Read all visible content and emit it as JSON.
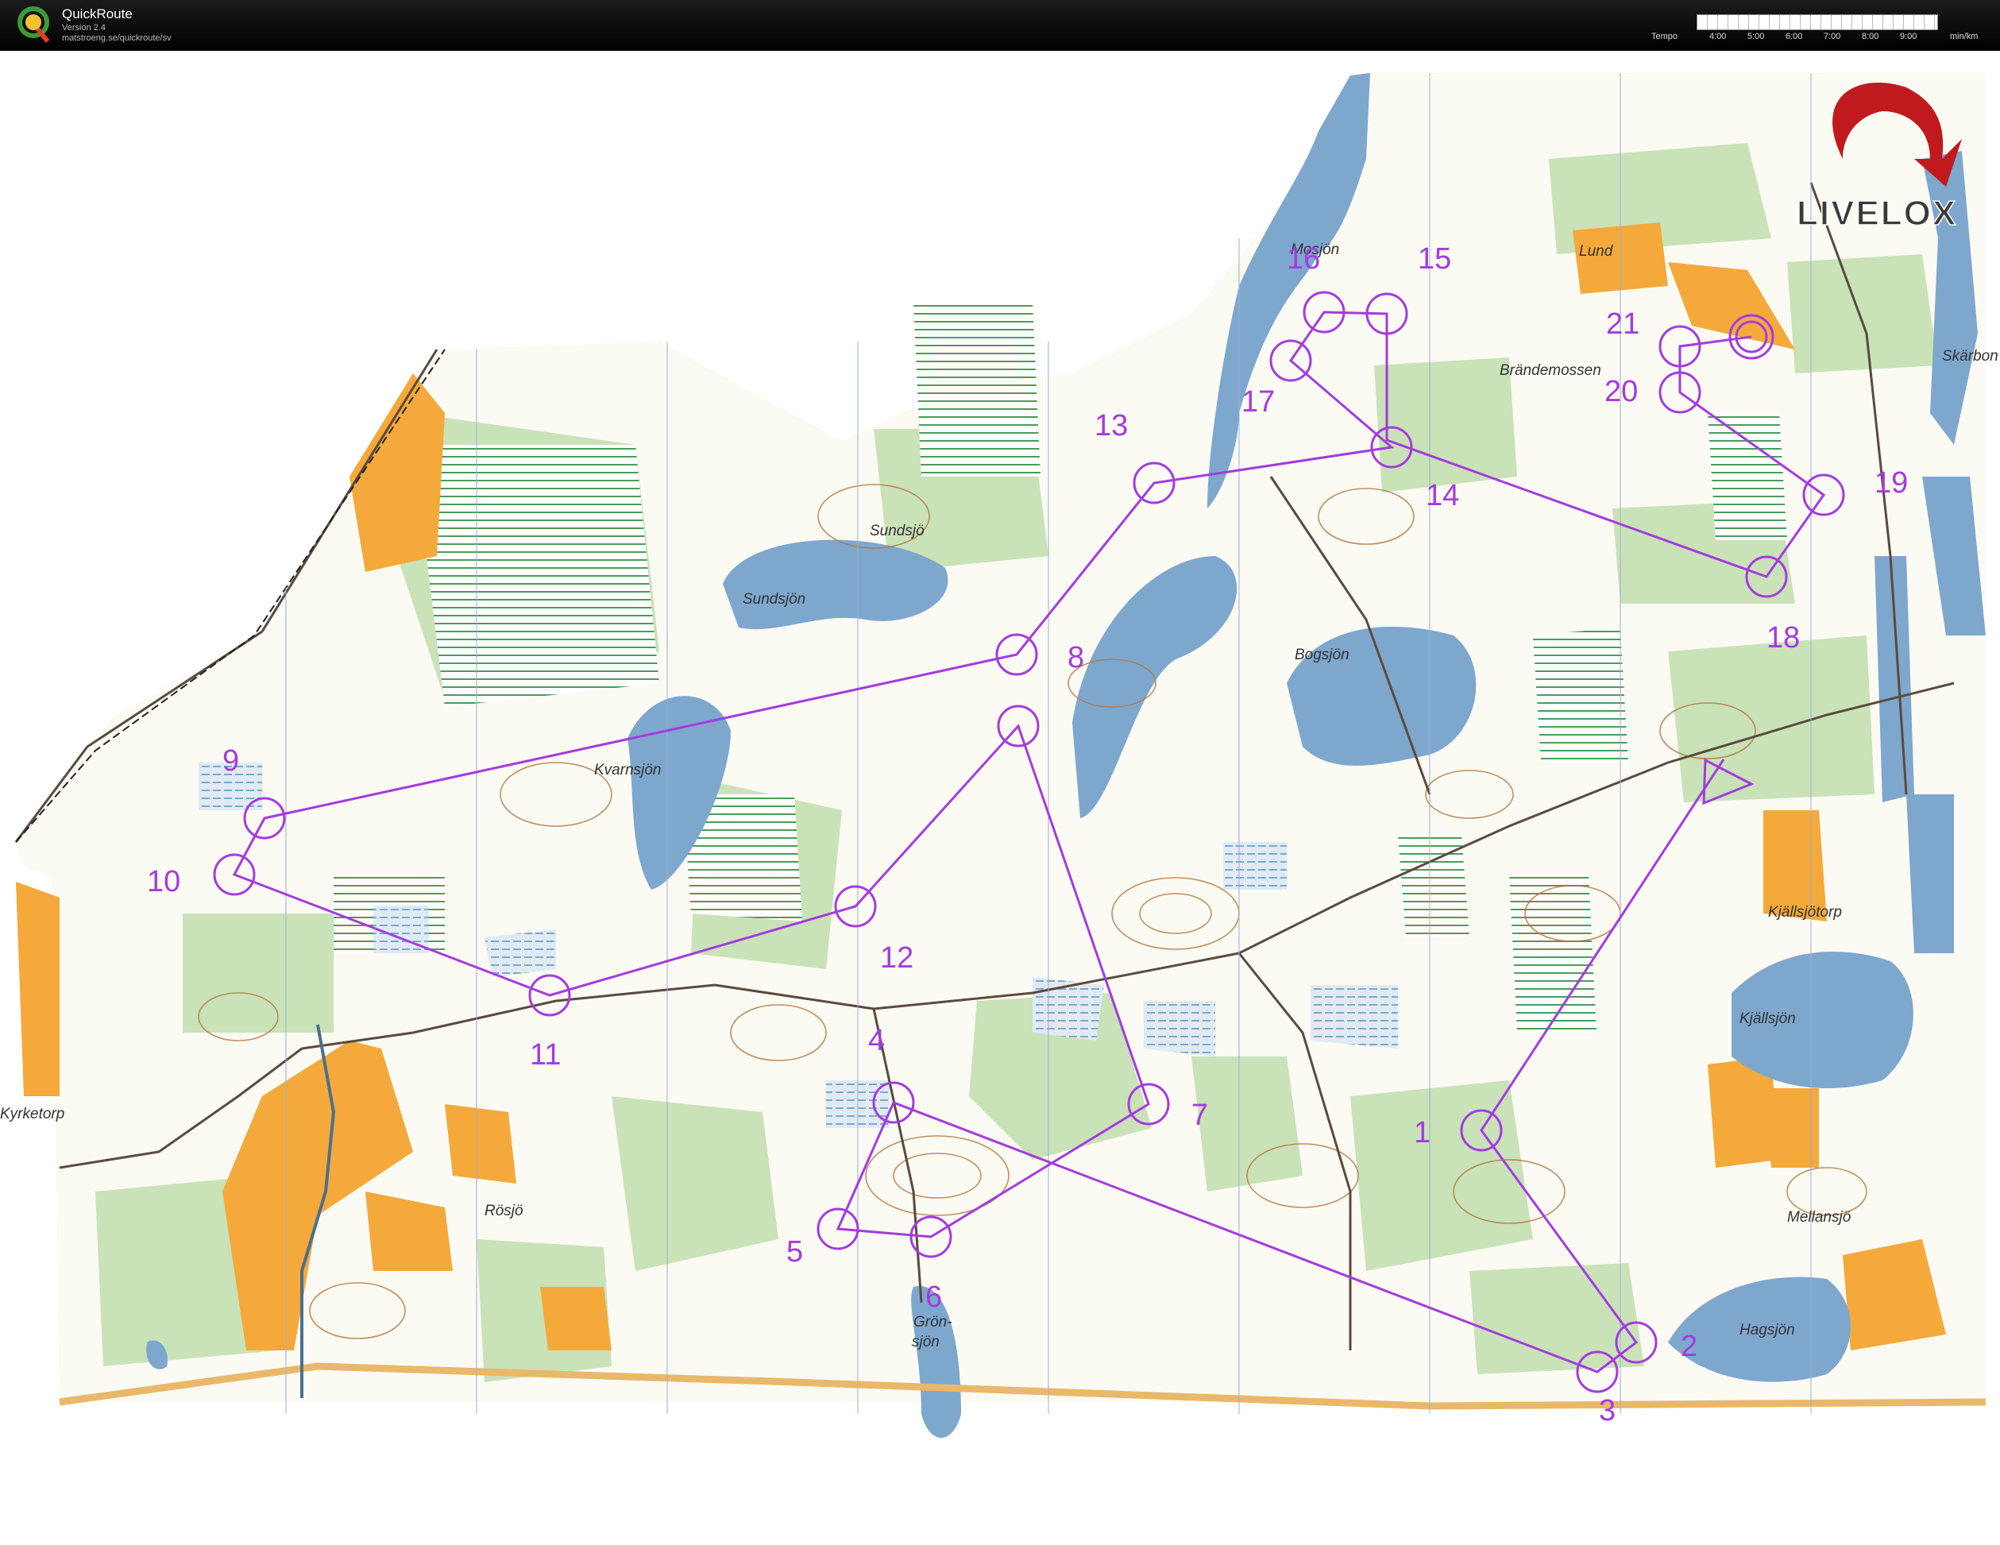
{
  "app": {
    "name": "QuickRoute",
    "version": "Version 2.4",
    "url": "matstroeng.se/quickroute/sv",
    "tempo_label": "Tempo",
    "tempo_ticks": [
      "4:00",
      "5:00",
      "6:00",
      "7:00",
      "8:00",
      "9:00"
    ],
    "tempo_unit": "min/km"
  },
  "brand": {
    "text": "LIVELOX",
    "arrow_color": "#c0191e"
  },
  "map": {
    "course_color": "#a43be0",
    "colors": {
      "water": "#7ea7ce",
      "open_land": "#f4a93a",
      "green": "#c9e2b8",
      "marsh": "#4a9c5a",
      "contour": "#b4743a",
      "road": "#5b4a3e",
      "track": "#e9b86a"
    },
    "place_names": [
      "Sundsjö",
      "Sundsjön",
      "Kvarnsjön",
      "Bogsjön",
      "Kjällsjön",
      "Hagsjön",
      "Grön-",
      "sjön",
      "Rösjö",
      "Kyrketorp",
      "Kjällsjötorp",
      "Mellansjö",
      "Lund",
      "Brändemossen",
      "Skärbon",
      "Mosjön"
    ],
    "control_labels": [
      "1",
      "2",
      "3",
      "4",
      "5",
      "6",
      "7",
      "8",
      "9",
      "10",
      "11",
      "12",
      "13",
      "14",
      "15",
      "16",
      "17",
      "18",
      "19",
      "20",
      "21"
    ]
  }
}
